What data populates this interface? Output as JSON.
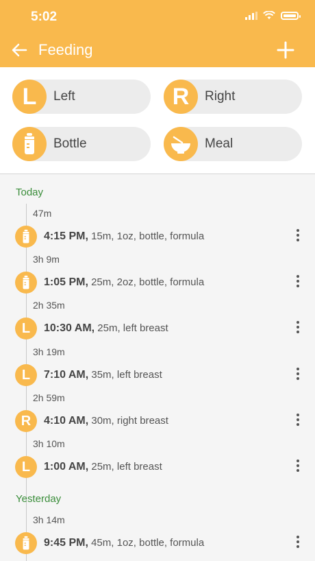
{
  "status_bar": {
    "time": "5:02"
  },
  "header": {
    "title": "Feeding"
  },
  "quick_add": [
    {
      "label": "Left",
      "icon": "L"
    },
    {
      "label": "Right",
      "icon": "R"
    },
    {
      "label": "Bottle",
      "icon": "bottle-icon"
    },
    {
      "label": "Meal",
      "icon": "bowl-icon"
    }
  ],
  "timeline": {
    "today_label": "Today",
    "yesterday_label": "Yesterday",
    "gaps": [
      "47m",
      "3h 9m",
      "2h 35m",
      "3h 19m",
      "2h 59m",
      "3h 10m",
      "3h 14m"
    ],
    "entries": [
      {
        "time": "4:15 PM,",
        "details": "15m, 1oz, bottle, formula",
        "icon": "bottle-icon"
      },
      {
        "time": "1:05 PM,",
        "details": "25m, 2oz, bottle, formula",
        "icon": "bottle-icon"
      },
      {
        "time": "10:30 AM,",
        "details": "25m, left breast",
        "icon": "L"
      },
      {
        "time": "7:10 AM,",
        "details": "35m, left breast",
        "icon": "L"
      },
      {
        "time": "4:10 AM,",
        "details": "30m, right breast",
        "icon": "R"
      },
      {
        "time": "1:00 AM,",
        "details": "25m, left breast",
        "icon": "L"
      },
      {
        "time": "9:45 PM,",
        "details": "45m, 1oz, bottle, formula",
        "icon": "bottle-icon"
      }
    ]
  },
  "colors": {
    "accent": "#f9b94d",
    "day_label": "#3a8d3a"
  }
}
